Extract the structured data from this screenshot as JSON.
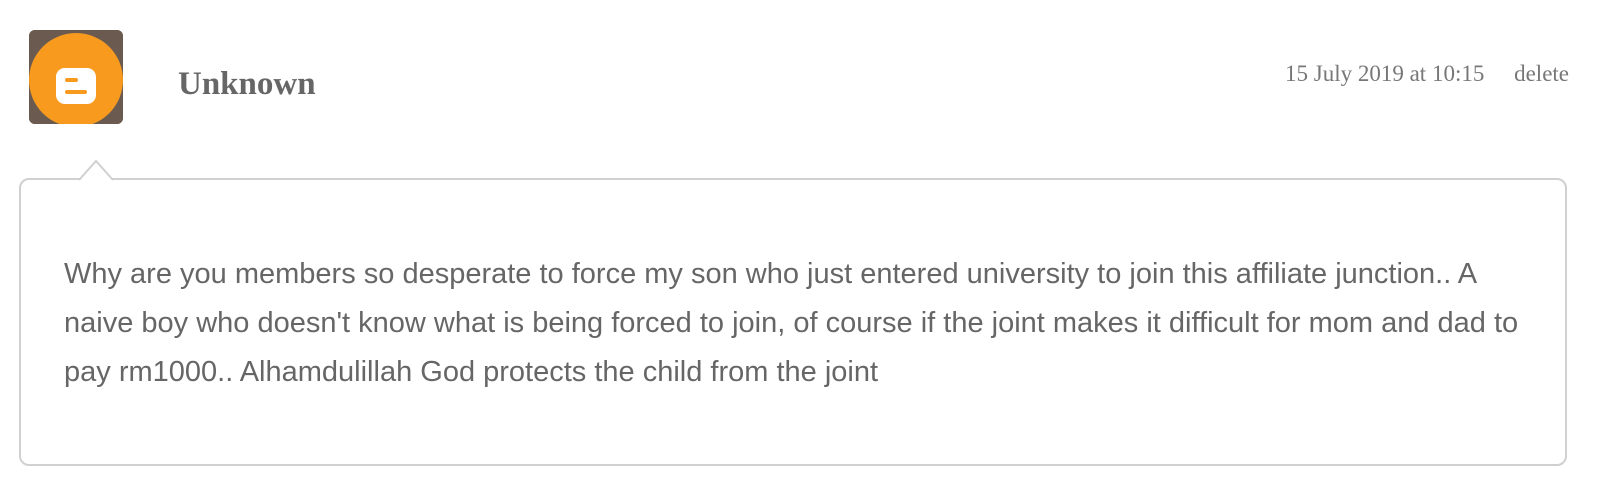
{
  "comment": {
    "author": "Unknown",
    "timestamp": "15 July 2019 at 10:15",
    "delete_label": "delete",
    "avatar_icon": "blogger-icon",
    "avatar_color": "#f79a1e",
    "body": "Why are you members so desperate to force my son who just entered university to join this affiliate junction.. A naive boy who doesn't know what is being forced to join, of course if the joint makes it difficult for mom and dad to pay rm1000.. Alhamdulillah God protects the child from the joint"
  }
}
